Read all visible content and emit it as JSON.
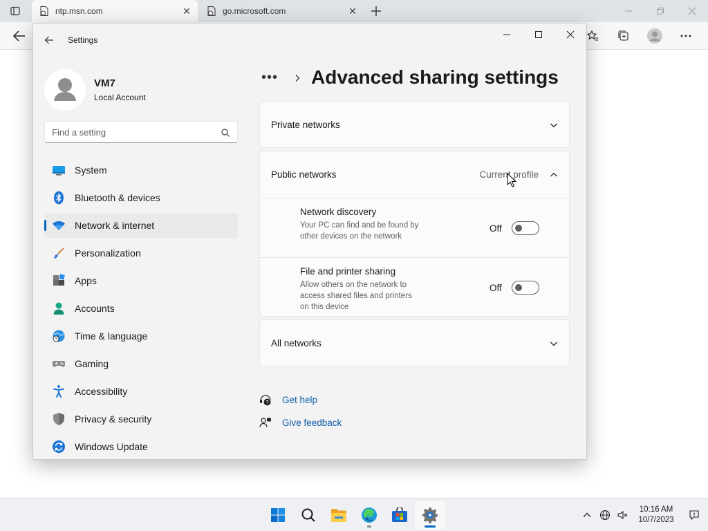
{
  "browser": {
    "tabs": [
      {
        "title": "ntp.msn.com",
        "active": true
      },
      {
        "title": "go.microsoft.com",
        "active": false
      }
    ]
  },
  "settings": {
    "window_title": "Settings",
    "user": {
      "name": "VM7",
      "type": "Local Account"
    },
    "search": {
      "placeholder": "Find a setting"
    },
    "nav": [
      {
        "label": "System",
        "icon": "system-icon"
      },
      {
        "label": "Bluetooth & devices",
        "icon": "bluetooth-icon"
      },
      {
        "label": "Network & internet",
        "icon": "wifi-icon",
        "selected": true
      },
      {
        "label": "Personalization",
        "icon": "brush-icon"
      },
      {
        "label": "Apps",
        "icon": "apps-icon"
      },
      {
        "label": "Accounts",
        "icon": "accounts-icon"
      },
      {
        "label": "Time & language",
        "icon": "globe-clock-icon"
      },
      {
        "label": "Gaming",
        "icon": "gamepad-icon"
      },
      {
        "label": "Accessibility",
        "icon": "accessibility-icon"
      },
      {
        "label": "Privacy & security",
        "icon": "shield-icon"
      },
      {
        "label": "Windows Update",
        "icon": "update-icon"
      }
    ],
    "breadcrumb": {
      "ellipsis": "•••",
      "title": "Advanced sharing settings"
    },
    "sections": {
      "private": {
        "title": "Private networks"
      },
      "public": {
        "title": "Public networks",
        "badge": "Current profile",
        "items": [
          {
            "title": "Network discovery",
            "desc": "Your PC can find and be found by other devices on the network",
            "state": "Off"
          },
          {
            "title": "File and printer sharing",
            "desc": "Allow others on the network to access shared files and printers on this device",
            "state": "Off"
          }
        ]
      },
      "all": {
        "title": "All networks"
      }
    },
    "links": {
      "help": "Get help",
      "feedback": "Give feedback"
    }
  },
  "taskbar": {
    "time": "10:16 AM",
    "date": "10/7/2023"
  },
  "colors": {
    "accent": "#0067c0",
    "link": "#0f5ea8"
  }
}
